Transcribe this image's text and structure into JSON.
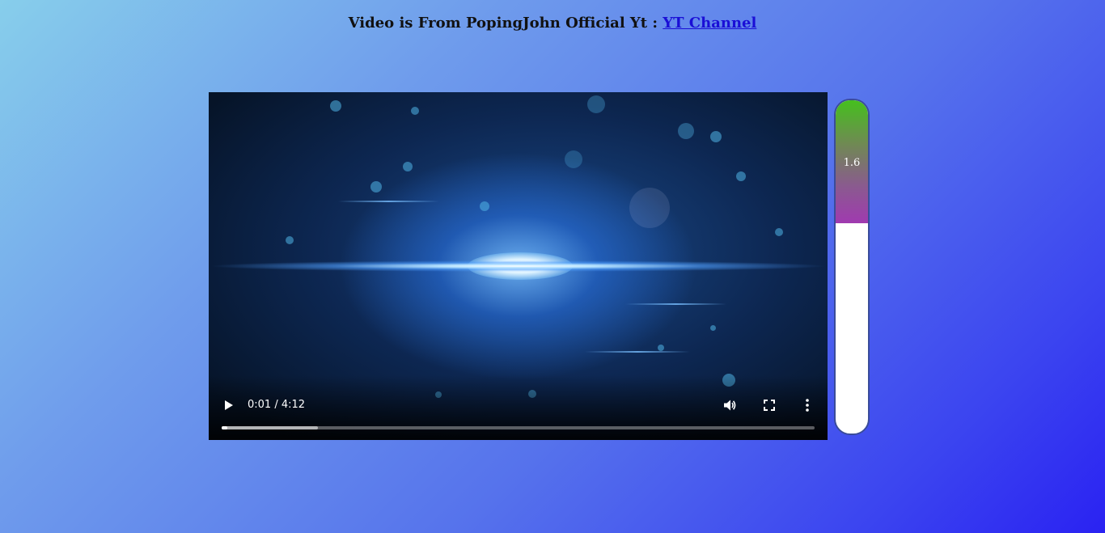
{
  "header": {
    "text": "Video is From PopingJohn Official Yt : ",
    "link_label": "YT Channel"
  },
  "player": {
    "time_display": "0:01 / 4:12",
    "played_fraction": 0.009,
    "buffered_fraction": 0.163,
    "icons": {
      "play": "play-icon",
      "volume": "volume-icon",
      "fullscreen": "fullscreen-icon",
      "more": "more-vertical-icon"
    }
  },
  "meter": {
    "value_label": "1.6",
    "fill_fraction": 0.37,
    "colors": {
      "top": "#45c01e",
      "bottom": "#a03ab0",
      "border": "#3a4c9a"
    }
  }
}
